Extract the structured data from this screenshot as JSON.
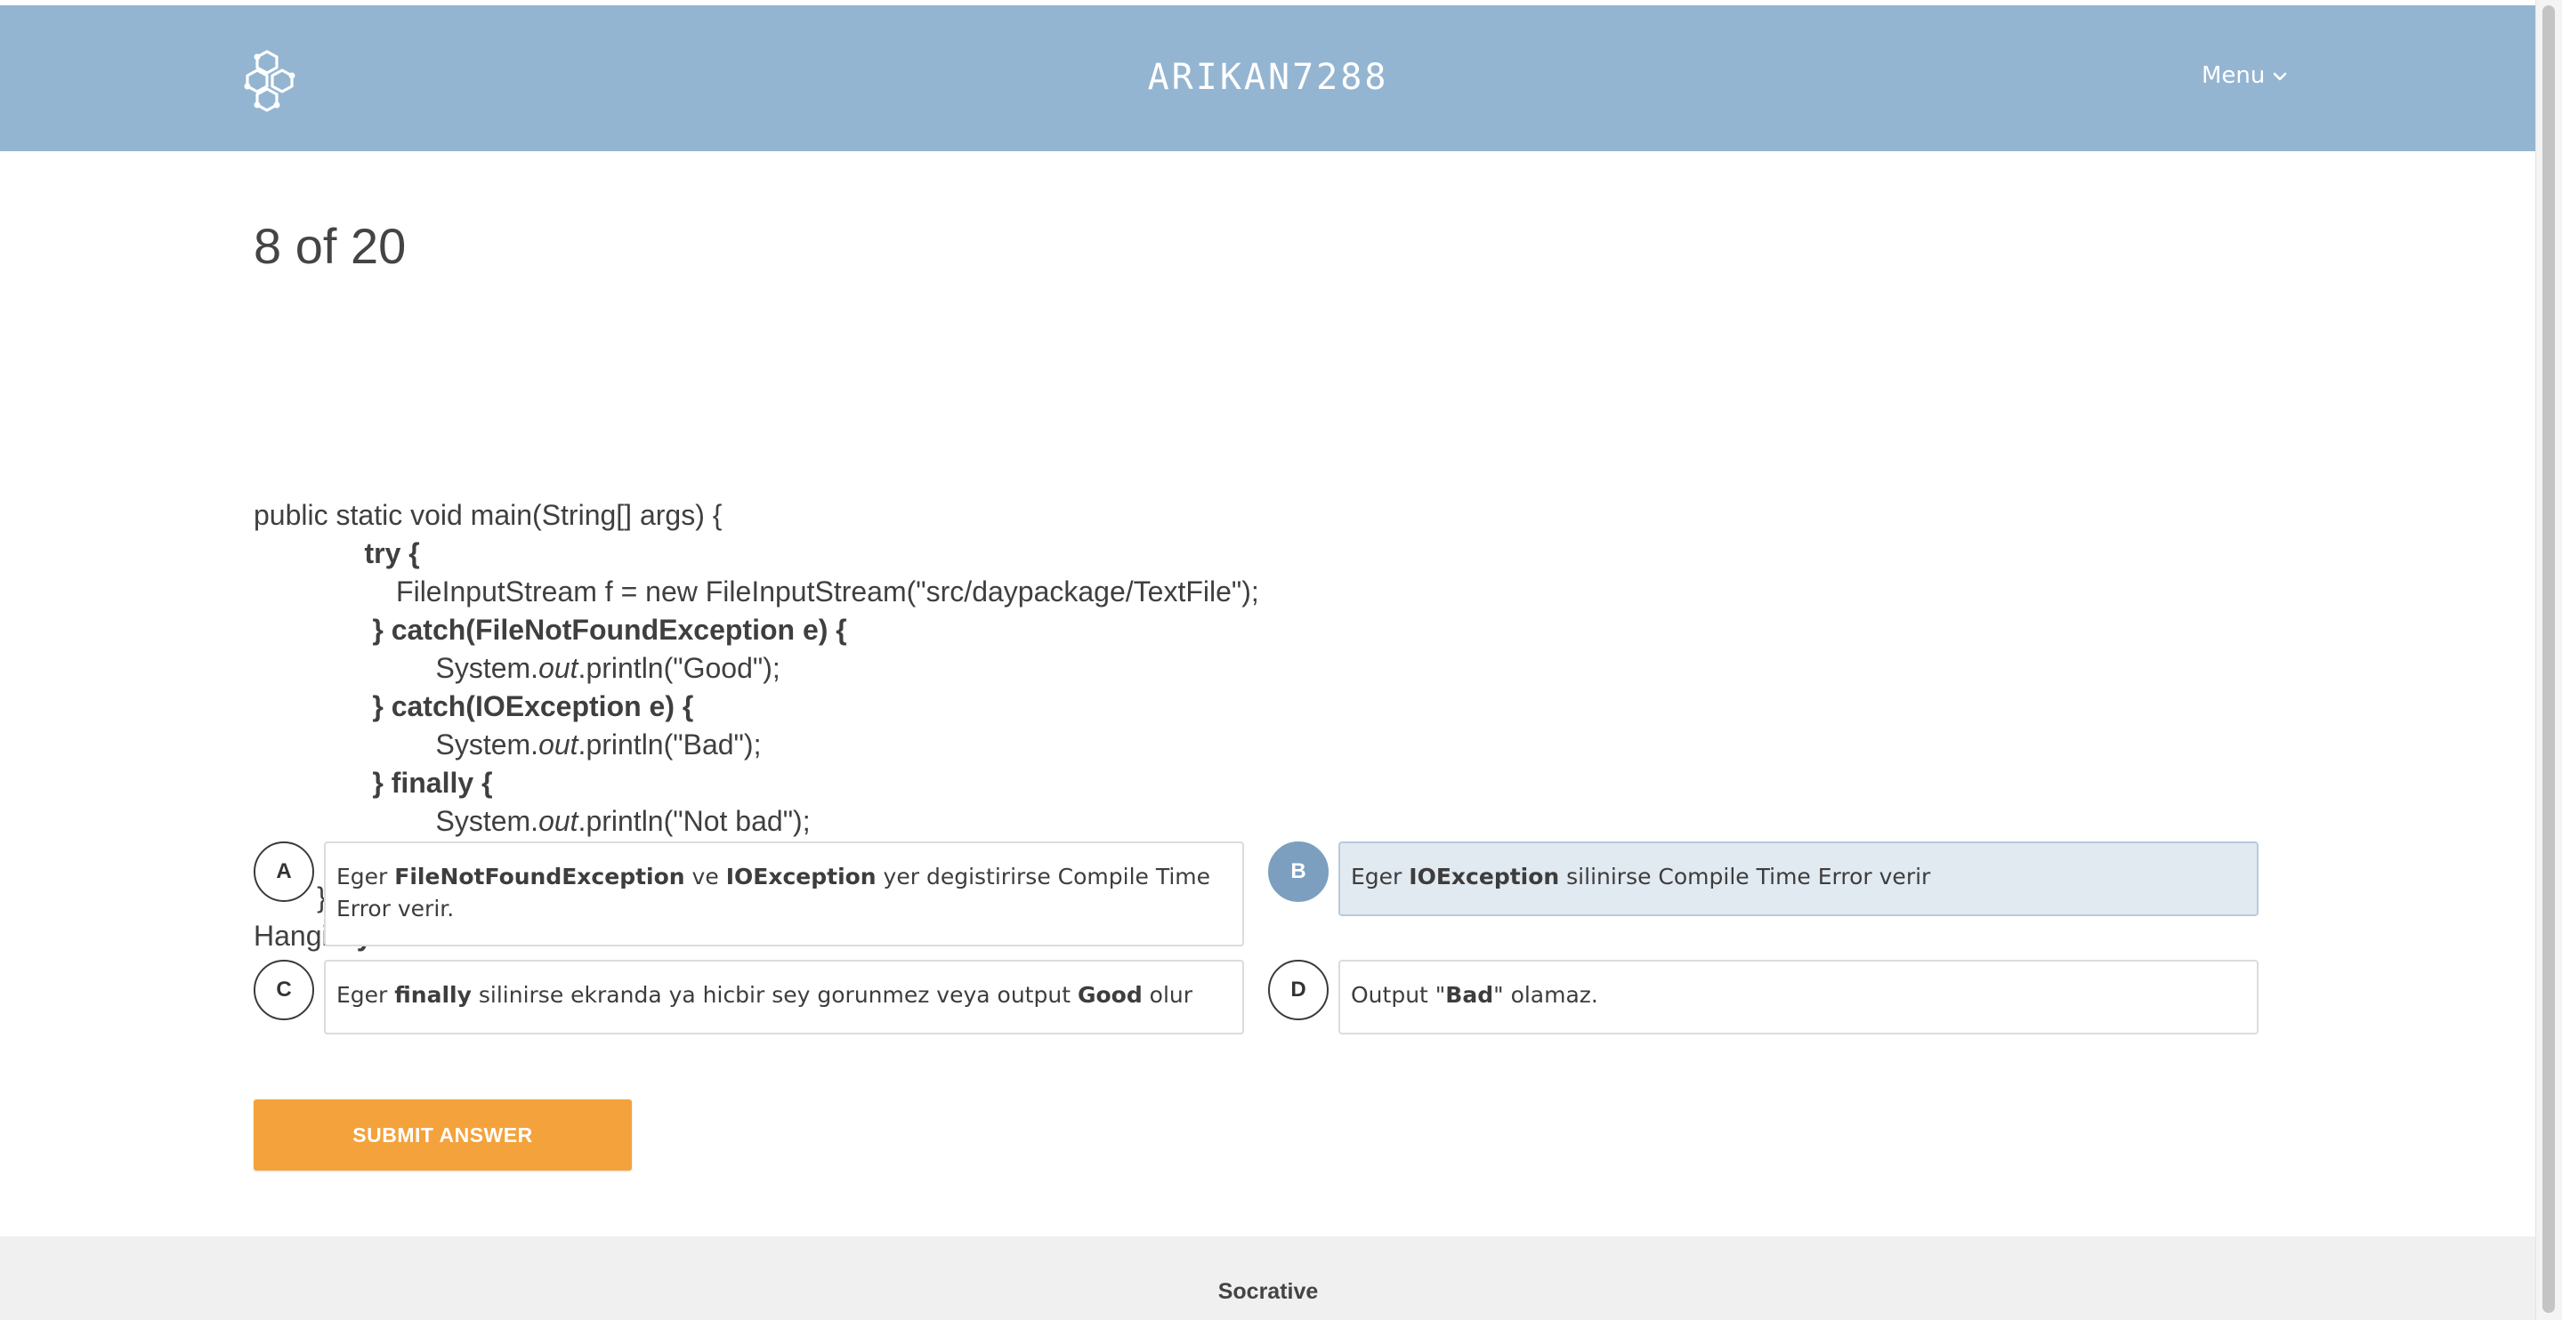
{
  "header": {
    "room_name": "ARIKAN7288",
    "menu_label": "Menu",
    "logo_icon": "honeycomb-logo-icon",
    "background": "#94b5d1"
  },
  "progress": {
    "text": "8 of 20",
    "current": 8,
    "total": 20
  },
  "question": {
    "lines": [
      [
        {
          "t": "public static void main(String[] args) {",
          "b": false
        }
      ],
      [
        {
          "t": "              ",
          "b": false
        },
        {
          "t": "try {",
          "b": true
        }
      ],
      [
        {
          "t": "                  FileInputStream f = new FileInputStream(\"src/daypackage/TextFile\");",
          "b": false
        }
      ],
      [
        {
          "t": "               ",
          "b": false
        },
        {
          "t": "} catch(FileNotFoundException e) {",
          "b": true
        }
      ],
      [
        {
          "t": "                       System.",
          "b": false
        },
        {
          "t": "out",
          "i": true
        },
        {
          "t": ".println(\"Good\");",
          "b": false
        }
      ],
      [
        {
          "t": "               ",
          "b": false
        },
        {
          "t": "} catch(IOException e) {",
          "b": true
        }
      ],
      [
        {
          "t": "                       System.",
          "b": false
        },
        {
          "t": "out",
          "i": true
        },
        {
          "t": ".println(\"Bad\");",
          "b": false
        }
      ],
      [
        {
          "t": "               ",
          "b": false
        },
        {
          "t": "} finally {",
          "b": true
        }
      ],
      [
        {
          "t": "                       System.",
          "b": false
        },
        {
          "t": "out",
          "i": true
        },
        {
          "t": ".println(\"Not bad\");",
          "b": false
        }
      ],
      [
        {
          "t": "          ",
          "b": false
        },
        {
          "t": "}",
          "b": true
        }
      ],
      [
        {
          "t": "        }",
          "b": false
        }
      ],
      [
        {
          "t": "Hangisi ",
          "b": false
        },
        {
          "t": "yanlistir",
          "b": true
        },
        {
          "t": "?",
          "b": false
        }
      ]
    ]
  },
  "answers": [
    {
      "letter": "A",
      "selected": false,
      "parts": [
        {
          "t": "Eger ",
          "b": false
        },
        {
          "t": "FileNotFoundException",
          "b": true
        },
        {
          "t": " ve ",
          "b": false
        },
        {
          "t": "IOException",
          "b": true
        },
        {
          "t": " yer degistirirse Compile Time Error verir.",
          "b": false
        }
      ]
    },
    {
      "letter": "B",
      "selected": true,
      "parts": [
        {
          "t": "Eger ",
          "b": false
        },
        {
          "t": "IOException",
          "b": true
        },
        {
          "t": " silinirse Compile Time Error verir",
          "b": false
        }
      ]
    },
    {
      "letter": "C",
      "selected": false,
      "parts": [
        {
          "t": "Eger ",
          "b": false
        },
        {
          "t": "finally",
          "b": true
        },
        {
          "t": " silinirse ekranda ya hicbir sey gorunmez veya output ",
          "b": false
        },
        {
          "t": "Good",
          "b": true
        },
        {
          "t": " olur",
          "b": false
        }
      ]
    },
    {
      "letter": "D",
      "selected": false,
      "parts": [
        {
          "t": "Output \"",
          "b": false
        },
        {
          "t": "Bad",
          "b": true
        },
        {
          "t": "\" olamaz.",
          "b": false
        }
      ]
    }
  ],
  "submit_label": "SUBMIT ANSWER",
  "footer": {
    "brand": "Socrative"
  },
  "colors": {
    "accent": "#f4a23b",
    "selected": "#7c9fbf",
    "selected_bg": "#e1e9f1"
  }
}
